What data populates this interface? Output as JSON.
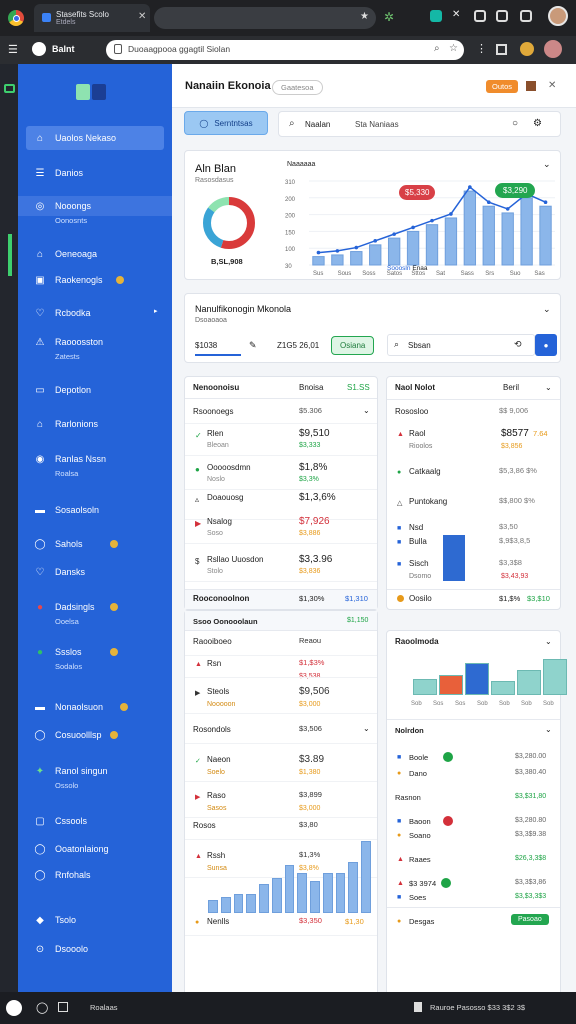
{
  "browser": {
    "tab_title": "Stasefits Scolo",
    "tab_sub": "Etdels",
    "address": "Duoaagpooa ggagtil Siolan",
    "profile_label": "Balnt"
  },
  "sidebar": {
    "items": [
      {
        "label": "Uaolos Nekaso",
        "active": true
      },
      {
        "label": "Danios"
      },
      {
        "label": "Nooongs",
        "sub": "Oonosnts",
        "highlight": true
      },
      {
        "label": "Oeneoaga"
      },
      {
        "label": "Raokenogls"
      },
      {
        "label": "Rcbodka"
      },
      {
        "label": "Raooosston",
        "sub": "Zatests"
      },
      {
        "label": "Depotlon"
      },
      {
        "label": "Rarlonions"
      },
      {
        "label": "Ranlas Nssn",
        "sub": "Roalsa"
      },
      {
        "label": "Sosaolsoln"
      },
      {
        "label": "Sahols"
      },
      {
        "label": "Dansks"
      },
      {
        "label": "Dadsingls",
        "sub": "Ooelsa"
      },
      {
        "label": "Ssslos",
        "sub": "Sodalos"
      },
      {
        "label": "Nonaolsuon"
      },
      {
        "label": "Cosuoolllsp"
      },
      {
        "label": "Ranol singun",
        "sub": "Ossolo"
      },
      {
        "label": "Cssools"
      },
      {
        "label": "Ooatonlaiong"
      },
      {
        "label": "Rnfohals"
      },
      {
        "label": "Tsolo"
      },
      {
        "label": "Dsooolo"
      }
    ]
  },
  "header": {
    "title": "Nanaiin Ekonoia",
    "chip": "Gaatesoa",
    "badge": "Outos"
  },
  "toolbar": {
    "primary_btn": "Serntntsas",
    "search_label": "Naalan",
    "search_hint": "Sta  Naniaas"
  },
  "summary": {
    "title": "Aln Blan",
    "subtitle": "Rasosdasus",
    "donut_value": "B,SL,908",
    "chart_title": "Naaaaaa",
    "tag_red": "$5,330",
    "tag_green": "$3,290",
    "legend": "Sooosln",
    "legend2": "Enaa",
    "y_ticks": [
      "310",
      "200",
      "200",
      "150",
      "100",
      "30"
    ],
    "x_ticks": [
      "Sus",
      "Sous",
      "Soss",
      "Satos",
      "Sttos",
      "Sat",
      "Sass",
      "Srs",
      "Suo",
      "Sas"
    ]
  },
  "chart_data": {
    "type": "bar",
    "categories": [
      "Sus",
      "Sous",
      "Soss",
      "Satos",
      "Sttos",
      "Sat",
      "Sass",
      "Srs",
      "Suo",
      "Sas"
    ],
    "series": [
      {
        "values": [
          10,
          12,
          16,
          24,
          32,
          40,
          48,
          56,
          88,
          70,
          62,
          80,
          70
        ]
      }
    ],
    "donut": [
      0.55,
      0.3,
      0.15
    ]
  },
  "section2": {
    "title": "Nanulfikonogin Mkonola",
    "sub": "Dsoaoaoa",
    "f1": "$1038",
    "f2": "Z1G5 26,01",
    "btn": "Osiana",
    "search": "Sbsan"
  },
  "panel_left_top": {
    "head": "Nenoonoisu",
    "head_mid": "Bnoisa",
    "head_val": "S1.SS",
    "rows": [
      {
        "name": "Rsoonoegs",
        "val": "$5.306",
        "sub": "",
        "c": "gr"
      },
      {
        "name": "Rlen",
        "sub": "Bleoan",
        "val": "$9,510",
        "sub2": "$3,333",
        "c": "g"
      },
      {
        "name": "Ooooosdmn",
        "sub": "Noslo",
        "val": "$1,8%",
        "sub2": "$3,3%",
        "c": "g"
      },
      {
        "name": "Doaouosg",
        "sub": "",
        "val": "$1,3,6%",
        "sub2": "",
        "c": "gr"
      },
      {
        "name": "Nsalog",
        "sub": "Soso",
        "val": "$7,926",
        "sub2": "$3,886",
        "c": "r"
      },
      {
        "name": "Rsllao Uuosdon",
        "sub": "Stolo",
        "val": "$3,3.96",
        "sub2": "$3,836",
        "c": "b"
      }
    ],
    "footer": "Rooconoolnon",
    "footer_val": "$1,30%",
    "footer_val2": "$1,310"
  },
  "panel_right_top": {
    "head": "Naol Nolot",
    "head_val": "Beril",
    "rows": [
      {
        "name": "Rososloo",
        "val": "$$ 9,006"
      },
      {
        "name": "Raol",
        "sub": "Rioolos",
        "val": "$8577",
        "val2": "7.64",
        "sub2": "$3,856"
      },
      {
        "name": "Catkaalg",
        "val": "$5,3,86 $%"
      },
      {
        "name": "Puntokang",
        "val": "$$,800 $%"
      },
      {
        "name": "Nsd",
        "val": "$3,50"
      },
      {
        "name": "Bulla",
        "val": "$,9$3,8,5"
      },
      {
        "name": "Sisch",
        "sub": "Dsomo",
        "val": "$3,3$8",
        "sub2": "$3,43,93"
      }
    ],
    "footer": "Oosilo",
    "footer_val": "$1,$%",
    "footer_val2": "$3,$10"
  },
  "panel_left_bot": {
    "head": "Ssoo Oonooolaun",
    "head_val": "$1,150",
    "rows": [
      {
        "name": "Raooiboeo",
        "val": "Reaou"
      },
      {
        "name": "Rsn",
        "sub": "",
        "val": "$1,$3%",
        "sub2": "$3,538"
      },
      {
        "name": "Steols",
        "sub": "Nooooon",
        "val": "$9,506",
        "sub2": "$3,000"
      },
      {
        "name": "Rosondols",
        "val": "$3,506"
      },
      {
        "name": "Naeon",
        "sub": "Soelo",
        "val": "$3.89",
        "sub2": "$1,380"
      },
      {
        "name": "Raso",
        "sub": "Sasos",
        "val": "$3,899",
        "sub2": "$3,000"
      },
      {
        "name": "Rosos",
        "val": "$3,80"
      },
      {
        "name": "Rssh",
        "sub": "Sunsa",
        "val": "$1,3%",
        "sub2": "$3,8%"
      },
      {
        "name": "Nenlls",
        "val": "$3,350",
        "val2": "$1,30"
      }
    ],
    "bars": [
      10,
      12,
      14,
      14,
      22,
      26,
      36,
      30,
      24,
      30,
      30,
      38,
      54
    ]
  },
  "panel_right_bot": {
    "head": "Raoolmoda",
    "bars": [
      18,
      22,
      36,
      16,
      28,
      40
    ],
    "x_ticks": [
      "Sob",
      "Sos",
      "Sos",
      "Sob",
      "Sob",
      "Sob",
      "Sob"
    ],
    "sub_head": "Nolrdon",
    "rows": [
      {
        "name": "Boole",
        "val": "$3,280.00"
      },
      {
        "name": "Dano",
        "val": "$3,380.40"
      },
      {
        "name": "Rasnon",
        "val": "$3,$31,80"
      },
      {
        "name": "Baoon",
        "val": "$3,280.80"
      },
      {
        "name": "Soano",
        "val": "$3,3$9.38"
      },
      {
        "name": "Raaes",
        "val": "$26,3,3$8"
      },
      {
        "name": "$3 3974",
        "val": "$3,3$3,86"
      },
      {
        "name": "Soes",
        "val": "$3,$3,3$3"
      },
      {
        "name": "Desgas",
        "val": "Pasoao"
      }
    ]
  },
  "taskbar": {
    "app": "Roalaas",
    "status": "Rauroe Pasosso $33 3$2 3$"
  },
  "colors": {
    "accent": "#2563d8",
    "green": "#1ea446",
    "red": "#d3303a",
    "orange": "#e79a1a"
  }
}
